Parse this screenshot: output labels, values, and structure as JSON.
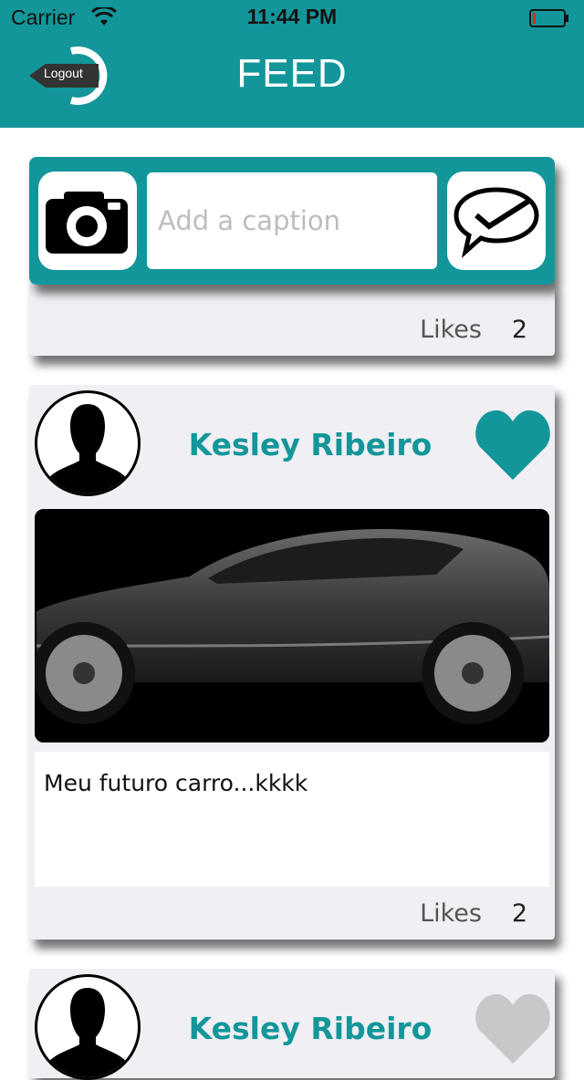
{
  "status_bar": {
    "carrier": "Carrier",
    "time": "11:44 PM"
  },
  "header": {
    "title": "FEED",
    "logout_label": "Logout"
  },
  "composer": {
    "caption_placeholder": "Add a caption",
    "caption_value": ""
  },
  "posts": [
    {
      "likes_label": "Likes",
      "likes": "2"
    },
    {
      "author": "Kesley Ribeiro",
      "liked": true,
      "caption": "Meu futuro carro...kkkk",
      "likes_label": "Likes",
      "likes": "2"
    },
    {
      "author": "Kesley Ribeiro",
      "liked": false
    }
  ],
  "colors": {
    "accent": "#13969a",
    "card_bg": "#efeff4",
    "heart_inactive": "#c8c8c8",
    "battery_low": "#e0261b"
  },
  "icons": [
    "wifi-icon",
    "battery-icon",
    "logout-icon",
    "camera-icon",
    "send-checkmark-icon",
    "heart-icon",
    "avatar-silhouette-icon"
  ]
}
